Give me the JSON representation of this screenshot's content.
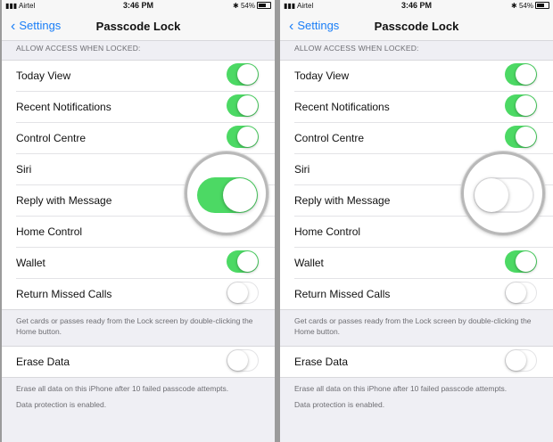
{
  "status": {
    "carrier": "Airtel",
    "time": "3:46 PM",
    "battery": "54%"
  },
  "nav": {
    "back_label": "Settings",
    "title": "Passcode Lock"
  },
  "section_header": "ALLOW ACCESS WHEN LOCKED:",
  "rows": [
    {
      "label": "Today View"
    },
    {
      "label": "Recent Notifications"
    },
    {
      "label": "Control Centre"
    },
    {
      "label": "Siri"
    },
    {
      "label": "Reply with Message"
    },
    {
      "label": "Home Control"
    },
    {
      "label": "Wallet"
    },
    {
      "label": "Return Missed Calls"
    }
  ],
  "footer1": "Get cards or passes ready from the Lock screen by double-clicking the Home button.",
  "erase": {
    "label": "Erase Data"
  },
  "footer2": "Erase all data on this iPhone after 10 failed passcode attempts.",
  "footer3": "Data protection is enabled.",
  "screens": [
    {
      "toggles": {
        "today_view": true,
        "recent_notifications": true,
        "control_centre": true,
        "siri": null,
        "reply_with_message": true,
        "home_control": null,
        "wallet": true,
        "return_missed_calls": false,
        "erase_data": false
      }
    },
    {
      "toggles": {
        "today_view": true,
        "recent_notifications": true,
        "control_centre": true,
        "siri": null,
        "reply_with_message": false,
        "home_control": null,
        "wallet": true,
        "return_missed_calls": false,
        "erase_data": false
      }
    }
  ],
  "colors": {
    "switch_on": "#4cd964",
    "link": "#1a7ef7",
    "background": "#efeff4"
  }
}
